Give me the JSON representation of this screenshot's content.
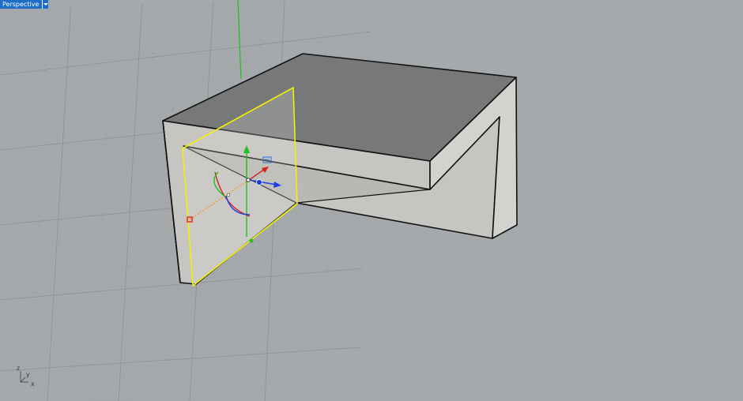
{
  "viewport": {
    "name": "Perspective",
    "background_color": "#a6a9ab",
    "grid_color": "#9a9ea1",
    "grid_major_color": "#8f9396",
    "selection_color": "#f2f200"
  },
  "axes": {
    "x_label": "x",
    "y_label": "y",
    "z_label": "z",
    "x_axis_color": "#d9201c",
    "y_axis_color": "#1fbf1f",
    "z_axis_color": "#1e3ee0"
  },
  "icons": {
    "dropdown": "chevron-down-icon",
    "gizmo": "gumball-gizmo-icon",
    "axis_indicator": "world-axes-icon"
  }
}
